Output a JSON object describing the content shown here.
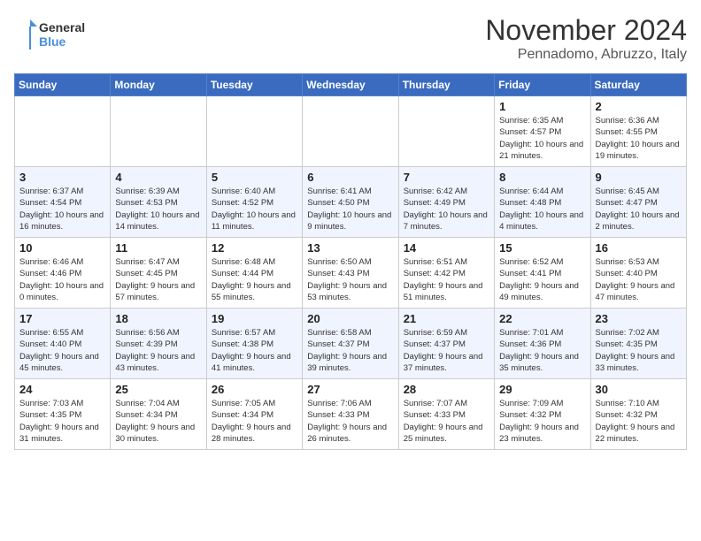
{
  "header": {
    "logo_general": "General",
    "logo_blue": "Blue",
    "month": "November 2024",
    "location": "Pennadomo, Abruzzo, Italy"
  },
  "weekdays": [
    "Sunday",
    "Monday",
    "Tuesday",
    "Wednesday",
    "Thursday",
    "Friday",
    "Saturday"
  ],
  "weeks": [
    [
      {
        "day": "",
        "info": ""
      },
      {
        "day": "",
        "info": ""
      },
      {
        "day": "",
        "info": ""
      },
      {
        "day": "",
        "info": ""
      },
      {
        "day": "",
        "info": ""
      },
      {
        "day": "1",
        "info": "Sunrise: 6:35 AM\nSunset: 4:57 PM\nDaylight: 10 hours and 21 minutes."
      },
      {
        "day": "2",
        "info": "Sunrise: 6:36 AM\nSunset: 4:55 PM\nDaylight: 10 hours and 19 minutes."
      }
    ],
    [
      {
        "day": "3",
        "info": "Sunrise: 6:37 AM\nSunset: 4:54 PM\nDaylight: 10 hours and 16 minutes."
      },
      {
        "day": "4",
        "info": "Sunrise: 6:39 AM\nSunset: 4:53 PM\nDaylight: 10 hours and 14 minutes."
      },
      {
        "day": "5",
        "info": "Sunrise: 6:40 AM\nSunset: 4:52 PM\nDaylight: 10 hours and 11 minutes."
      },
      {
        "day": "6",
        "info": "Sunrise: 6:41 AM\nSunset: 4:50 PM\nDaylight: 10 hours and 9 minutes."
      },
      {
        "day": "7",
        "info": "Sunrise: 6:42 AM\nSunset: 4:49 PM\nDaylight: 10 hours and 7 minutes."
      },
      {
        "day": "8",
        "info": "Sunrise: 6:44 AM\nSunset: 4:48 PM\nDaylight: 10 hours and 4 minutes."
      },
      {
        "day": "9",
        "info": "Sunrise: 6:45 AM\nSunset: 4:47 PM\nDaylight: 10 hours and 2 minutes."
      }
    ],
    [
      {
        "day": "10",
        "info": "Sunrise: 6:46 AM\nSunset: 4:46 PM\nDaylight: 10 hours and 0 minutes."
      },
      {
        "day": "11",
        "info": "Sunrise: 6:47 AM\nSunset: 4:45 PM\nDaylight: 9 hours and 57 minutes."
      },
      {
        "day": "12",
        "info": "Sunrise: 6:48 AM\nSunset: 4:44 PM\nDaylight: 9 hours and 55 minutes."
      },
      {
        "day": "13",
        "info": "Sunrise: 6:50 AM\nSunset: 4:43 PM\nDaylight: 9 hours and 53 minutes."
      },
      {
        "day": "14",
        "info": "Sunrise: 6:51 AM\nSunset: 4:42 PM\nDaylight: 9 hours and 51 minutes."
      },
      {
        "day": "15",
        "info": "Sunrise: 6:52 AM\nSunset: 4:41 PM\nDaylight: 9 hours and 49 minutes."
      },
      {
        "day": "16",
        "info": "Sunrise: 6:53 AM\nSunset: 4:40 PM\nDaylight: 9 hours and 47 minutes."
      }
    ],
    [
      {
        "day": "17",
        "info": "Sunrise: 6:55 AM\nSunset: 4:40 PM\nDaylight: 9 hours and 45 minutes."
      },
      {
        "day": "18",
        "info": "Sunrise: 6:56 AM\nSunset: 4:39 PM\nDaylight: 9 hours and 43 minutes."
      },
      {
        "day": "19",
        "info": "Sunrise: 6:57 AM\nSunset: 4:38 PM\nDaylight: 9 hours and 41 minutes."
      },
      {
        "day": "20",
        "info": "Sunrise: 6:58 AM\nSunset: 4:37 PM\nDaylight: 9 hours and 39 minutes."
      },
      {
        "day": "21",
        "info": "Sunrise: 6:59 AM\nSunset: 4:37 PM\nDaylight: 9 hours and 37 minutes."
      },
      {
        "day": "22",
        "info": "Sunrise: 7:01 AM\nSunset: 4:36 PM\nDaylight: 9 hours and 35 minutes."
      },
      {
        "day": "23",
        "info": "Sunrise: 7:02 AM\nSunset: 4:35 PM\nDaylight: 9 hours and 33 minutes."
      }
    ],
    [
      {
        "day": "24",
        "info": "Sunrise: 7:03 AM\nSunset: 4:35 PM\nDaylight: 9 hours and 31 minutes."
      },
      {
        "day": "25",
        "info": "Sunrise: 7:04 AM\nSunset: 4:34 PM\nDaylight: 9 hours and 30 minutes."
      },
      {
        "day": "26",
        "info": "Sunrise: 7:05 AM\nSunset: 4:34 PM\nDaylight: 9 hours and 28 minutes."
      },
      {
        "day": "27",
        "info": "Sunrise: 7:06 AM\nSunset: 4:33 PM\nDaylight: 9 hours and 26 minutes."
      },
      {
        "day": "28",
        "info": "Sunrise: 7:07 AM\nSunset: 4:33 PM\nDaylight: 9 hours and 25 minutes."
      },
      {
        "day": "29",
        "info": "Sunrise: 7:09 AM\nSunset: 4:32 PM\nDaylight: 9 hours and 23 minutes."
      },
      {
        "day": "30",
        "info": "Sunrise: 7:10 AM\nSunset: 4:32 PM\nDaylight: 9 hours and 22 minutes."
      }
    ]
  ]
}
